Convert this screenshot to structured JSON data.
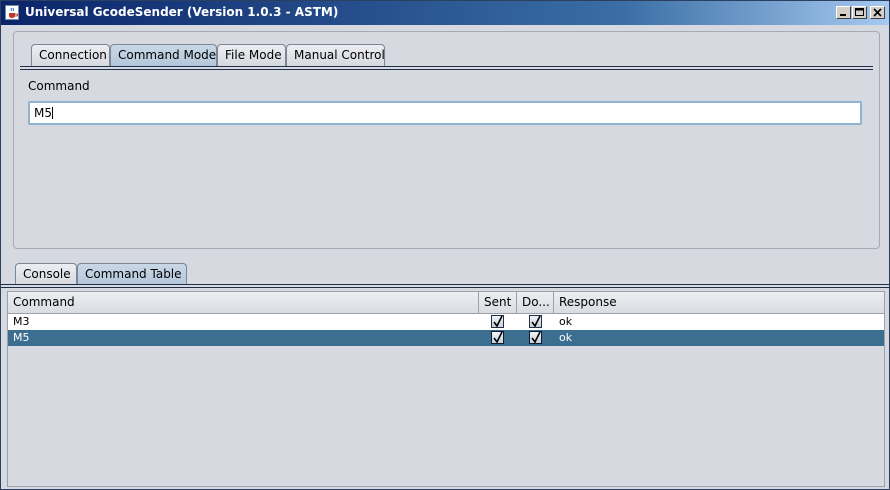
{
  "window": {
    "title": "Universal GcodeSender (Version 1.0.3 - ASTM)",
    "icon": "java-cup-icon",
    "controls": [
      "minimize-icon",
      "maximize-icon",
      "close-icon"
    ]
  },
  "top_tabs": [
    {
      "label": "Connection",
      "selected": false
    },
    {
      "label": "Command Mode",
      "selected": true
    },
    {
      "label": "File Mode",
      "selected": false
    },
    {
      "label": "Manual Control",
      "selected": false
    }
  ],
  "command_panel": {
    "label": "Command",
    "input_value": "M5"
  },
  "bottom_tabs": [
    {
      "label": "Console",
      "selected": false
    },
    {
      "label": "Command Table",
      "selected": true
    }
  ],
  "table": {
    "columns": [
      "Command",
      "Sent",
      "Do...",
      "Response"
    ],
    "rows": [
      {
        "command": "M3",
        "sent": true,
        "done": true,
        "response": "ok",
        "selected": false
      },
      {
        "command": "M5",
        "sent": true,
        "done": true,
        "response": "ok",
        "selected": true
      }
    ]
  },
  "colors": {
    "title_gradient_start": "#0a246a",
    "title_gradient_end": "#a6caf0",
    "selected_row": "#3b6e8f",
    "selected_tab": "#b3c7da",
    "input_border": "#8fb2d1"
  }
}
